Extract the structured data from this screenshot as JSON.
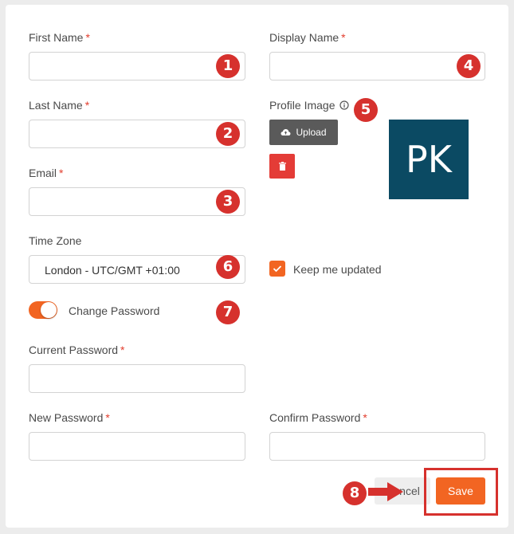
{
  "form": {
    "first_name": {
      "label": "First Name",
      "required": "*",
      "value": "",
      "step": "1"
    },
    "last_name": {
      "label": "Last Name",
      "required": "*",
      "value": "",
      "step": "2"
    },
    "email": {
      "label": "Email",
      "required": "*",
      "value": "",
      "step": "3"
    },
    "display_name": {
      "label": "Display Name",
      "required": "*",
      "value": "",
      "step": "4"
    },
    "profile_image": {
      "label": "Profile Image",
      "info_icon": "info-icon",
      "upload_label": "Upload",
      "upload_icon": "cloud-upload-icon",
      "delete_icon": "trash-icon",
      "avatar_initials": "PK",
      "avatar_color": "#0b4a63",
      "step": "5"
    },
    "time_zone": {
      "label": "Time Zone",
      "value": "London - UTC/GMT +01:00",
      "step": "6"
    },
    "keep_updated": {
      "label": "Keep me updated",
      "checked": true
    },
    "change_password": {
      "label": "Change Password",
      "on": true,
      "step": "7"
    },
    "current_password": {
      "label": "Current Password",
      "required": "*",
      "value": ""
    },
    "new_password": {
      "label": "New Password",
      "required": "*",
      "value": ""
    },
    "confirm_password": {
      "label": "Confirm Password",
      "required": "*",
      "value": ""
    }
  },
  "actions": {
    "cancel_label": "Cancel",
    "cancel_visible_text": "ncel",
    "save_label": "Save",
    "step": "8"
  },
  "colors": {
    "accent": "#f26522",
    "badge": "#d6312d",
    "required": "#e23d2d"
  }
}
